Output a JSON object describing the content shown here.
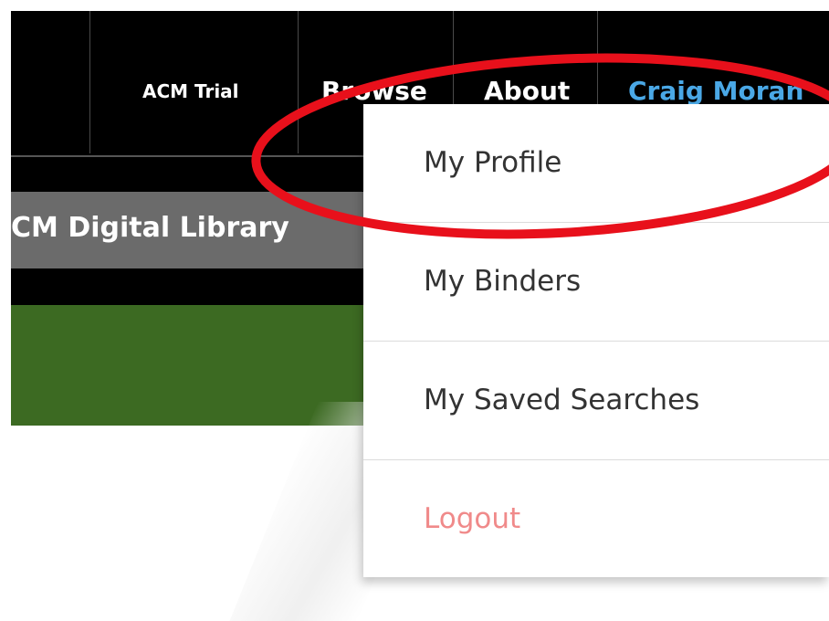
{
  "topnav": {
    "items": [
      {
        "label": "ACM Trial"
      },
      {
        "label": "Browse"
      },
      {
        "label": "About"
      }
    ],
    "user": {
      "name": "Craig Moran"
    }
  },
  "library": {
    "title": "CM Digital Library"
  },
  "dropdown": {
    "items": [
      {
        "label": "My Profile"
      },
      {
        "label": "My Binders"
      },
      {
        "label": "My Saved Searches"
      },
      {
        "label": "Logout"
      }
    ]
  },
  "colors": {
    "nav_background": "#000000",
    "user_link": "#4aa8e6",
    "library_bar": "#6b6b6b",
    "green_band": "#3c6a22",
    "logout_text": "#f08a8a",
    "annotation": "#e8101b"
  },
  "annotation": {
    "shape": "ellipse",
    "highlights": "My Profile"
  }
}
